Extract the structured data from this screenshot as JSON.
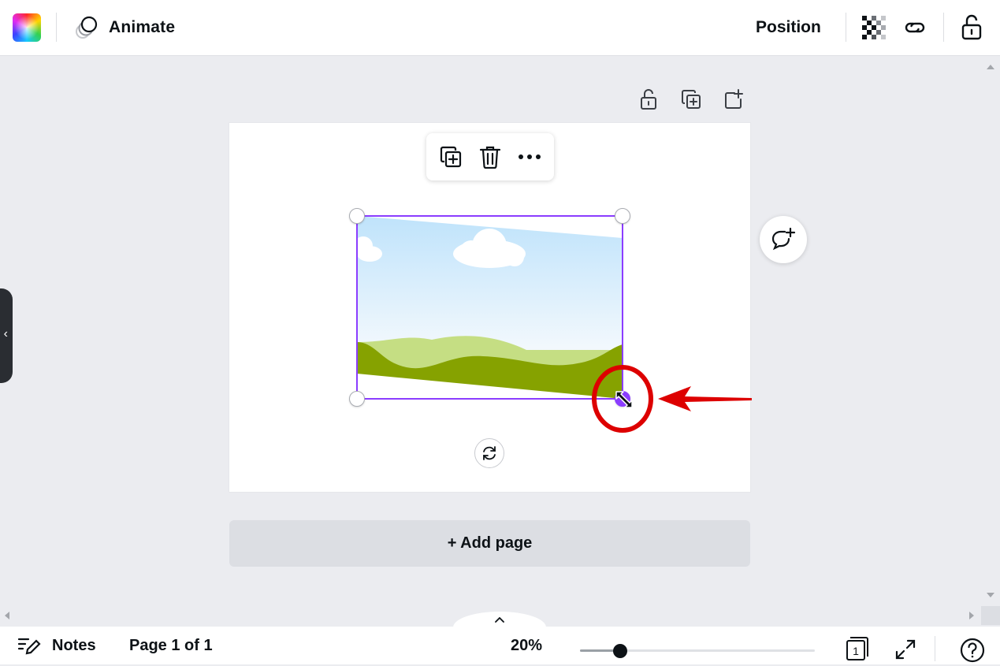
{
  "topbar": {
    "color_swatch_icon": "rainbow-color-swatch-icon",
    "animate_icon": "animate-circles-icon",
    "animate_label": "Animate",
    "position_label": "Position",
    "transparency_icon": "checkerboard-transparency-icon",
    "link_icon": "link-icon",
    "lock_icon": "unlocked-padlock-icon"
  },
  "page_tools": {
    "lock_icon": "unlocked-padlock-icon",
    "duplicate_icon": "duplicate-page-icon",
    "add_icon": "add-page-icon"
  },
  "context_toolbar": {
    "duplicate_icon": "duplicate-icon",
    "delete_icon": "trash-icon",
    "more_icon": "more-dots-icon"
  },
  "image": {
    "placeholder_icon": "landscape-placeholder-image",
    "colors": {
      "sky_top": "#bfe3fb",
      "sky_bottom": "#f4f9fd",
      "hill_light": "#c5de83",
      "hill_dark": "#86a200"
    }
  },
  "selection": {
    "border_color": "#8b3dff"
  },
  "annotation": {
    "color": "#dd0000",
    "target": "bottom-right resize handle"
  },
  "buttons": {
    "add_page_label": "+ Add page",
    "comment_icon": "add-comment-icon",
    "rotate_icon": "rotate-icon"
  },
  "bottombar": {
    "notes_label": "Notes",
    "page_indicator": "Page 1 of 1",
    "zoom": "20%",
    "zoom_level": 0.17,
    "pages_count": "1",
    "fullscreen_icon": "expand-icon",
    "help_icon": "help-question-icon"
  }
}
